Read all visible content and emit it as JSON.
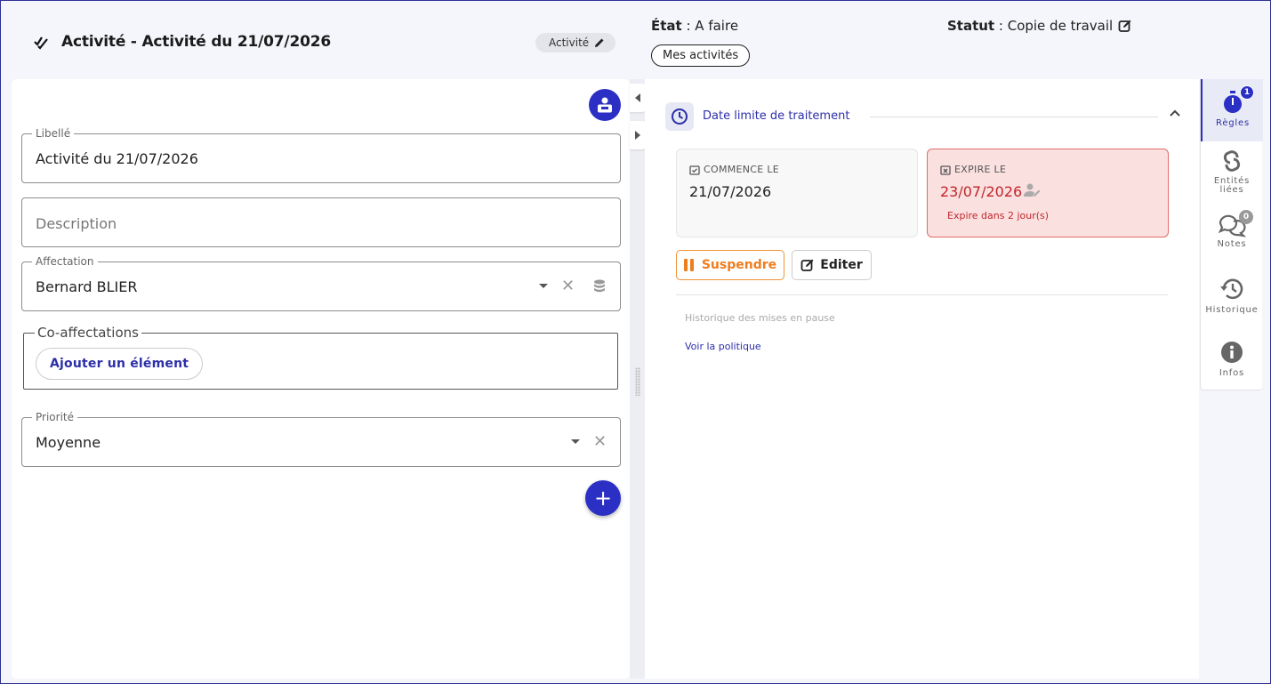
{
  "header": {
    "title": "Activité - Activité du 21/07/2026",
    "type_chip": "Activité",
    "etat_label": "État",
    "etat_value": " : A faire",
    "mes_activites": "Mes activités",
    "statut_label": "Statut",
    "statut_value": " : Copie de travail"
  },
  "form": {
    "libelle": {
      "label": "Libellé",
      "value": "Activité du 21/07/2026"
    },
    "description": {
      "placeholder": "Description"
    },
    "affectation": {
      "label": "Affectation",
      "value": "Bernard BLIER"
    },
    "coaffectations": {
      "label": "Co-affectations",
      "add_button": "Ajouter un élément"
    },
    "priorite": {
      "label": "Priorité",
      "value": "Moyenne"
    },
    "add_fab": "+"
  },
  "deadline": {
    "section_title": "Date limite de traitement",
    "start": {
      "label": "COMMENCE LE",
      "date": "21/07/2026"
    },
    "expire": {
      "label": "EXPIRE LE",
      "date": "23/07/2026",
      "note": "Expire dans 2 jour(s)"
    },
    "suspend_button": "Suspendre",
    "edit_button": "Editer",
    "pause_history": "Historique des mises en pause",
    "policy_link": "Voir la politique"
  },
  "sidenav": {
    "items": [
      {
        "label": "Règles",
        "badge": "1"
      },
      {
        "label": "Entités liées"
      },
      {
        "label": "Notes",
        "badge": "0"
      },
      {
        "label": "Historique"
      },
      {
        "label": "Infos"
      }
    ]
  },
  "colors": {
    "primary": "#2c2fc4",
    "danger": "#c0262b",
    "warning": "#ee7d1f"
  }
}
